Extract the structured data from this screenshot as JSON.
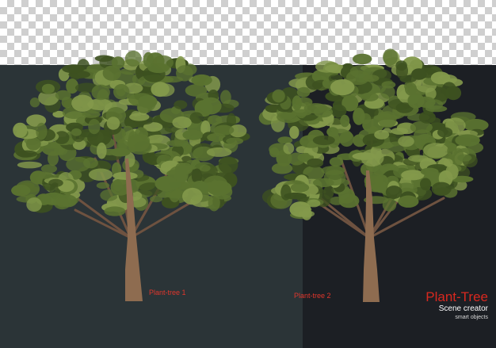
{
  "labels": {
    "tree_1": "Plant-tree 1",
    "tree_2": "Plant-tree 2"
  },
  "brand": {
    "title": "Plant-Tree",
    "subtitle": "Scene creator",
    "tagline": "smart objects"
  },
  "colors": {
    "transparency_checker": "#cfcfcf",
    "left_background": "#2b3437",
    "right_background": "#1c1f24",
    "label_red": "#e0362c",
    "brand_red": "#d8281f",
    "foliage_dark": "#3d5120",
    "foliage_mid": "#5a7230",
    "foliage_light": "#83994b",
    "trunk": "#8e6c50",
    "branch": "#6e5240"
  }
}
